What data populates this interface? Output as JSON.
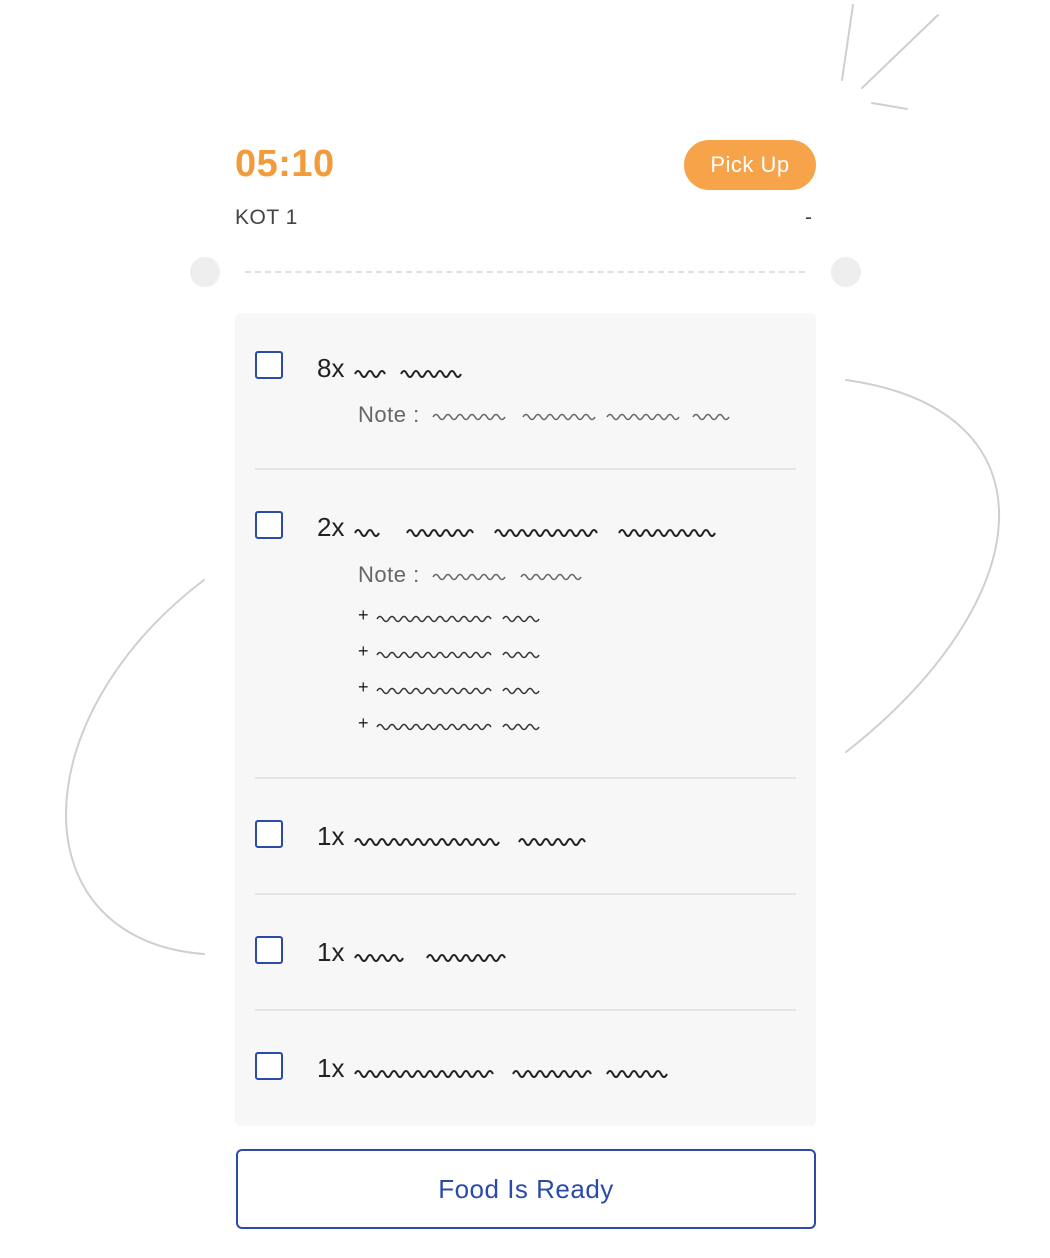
{
  "ticket": {
    "timer": "05:10",
    "pickup_label": "Pick Up",
    "kot_label": "KOT 1",
    "right_value": "-"
  },
  "colors": {
    "accent_orange": "#f39b3a",
    "pickup_bg": "#f6a34a",
    "primary_blue": "#2b4ba9",
    "panel_bg": "#f7f7f7"
  },
  "items": [
    {
      "qty": "8x",
      "checked": false,
      "note_label": "Note :",
      "addons": 0
    },
    {
      "qty": "2x",
      "checked": false,
      "note_label": "Note :",
      "addons": 4,
      "addon_prefix": "+"
    },
    {
      "qty": "1x",
      "checked": false
    },
    {
      "qty": "1x",
      "checked": false
    },
    {
      "qty": "1x",
      "checked": false
    }
  ],
  "footer": {
    "ready_label": "Food Is Ready"
  }
}
